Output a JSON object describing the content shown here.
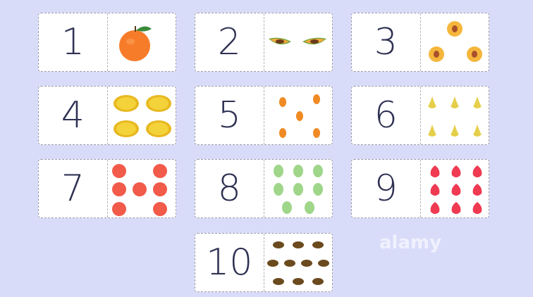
{
  "watermark": "alamy",
  "cards": [
    {
      "number": "1",
      "fruit": "tangerine-icon",
      "count": 1
    },
    {
      "number": "2",
      "fruit": "papaya-icon",
      "count": 2
    },
    {
      "number": "3",
      "fruit": "peach-icon",
      "count": 3
    },
    {
      "number": "4",
      "fruit": "mango-icon",
      "count": 4
    },
    {
      "number": "5",
      "fruit": "apricot-icon",
      "count": 5
    },
    {
      "number": "6",
      "fruit": "pear-icon",
      "count": 6
    },
    {
      "number": "7",
      "fruit": "grapefruit-icon",
      "count": 7
    },
    {
      "number": "8",
      "fruit": "melon-icon",
      "count": 8
    },
    {
      "number": "9",
      "fruit": "strawberry-icon",
      "count": 9
    },
    {
      "number": "10",
      "fruit": "feijoa-icon",
      "count": 10
    }
  ]
}
